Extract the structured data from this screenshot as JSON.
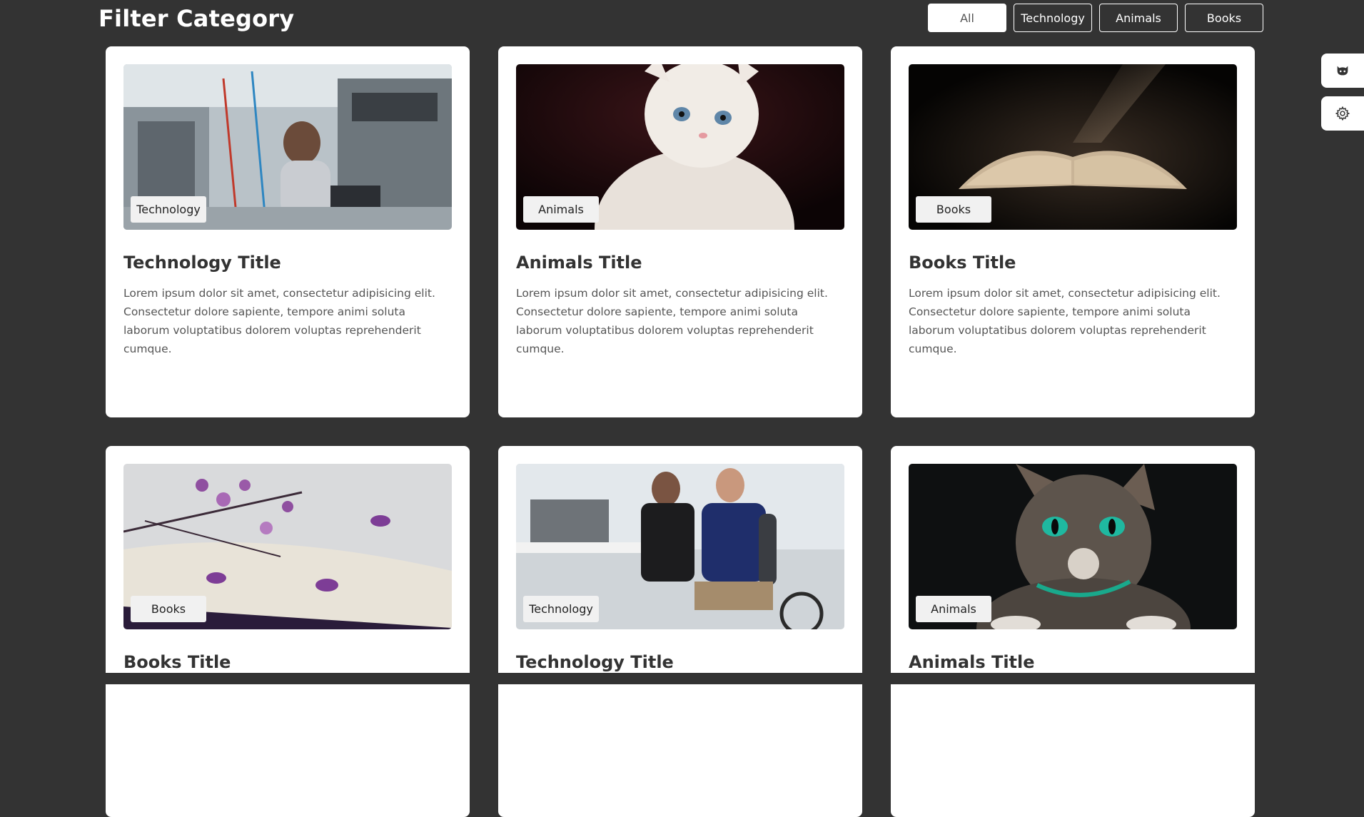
{
  "header": {
    "title": "Filter Category"
  },
  "filters": [
    {
      "label": "All",
      "active": true
    },
    {
      "label": "Technology",
      "active": false
    },
    {
      "label": "Animals",
      "active": false
    },
    {
      "label": "Books",
      "active": false
    }
  ],
  "cards": [
    {
      "tag": "Technology",
      "title": "Technology Title",
      "text": "Lorem ipsum dolor sit amet, consectetur adipisicing elit. Consectetur dolore sapiente, tempore animi soluta laborum voluptatibus dolorem voluptas reprehenderit cumque."
    },
    {
      "tag": "Animals",
      "title": "Animals Title",
      "text": "Lorem ipsum dolor sit amet, consectetur adipisicing elit. Consectetur dolore sapiente, tempore animi soluta laborum voluptatibus dolorem voluptas reprehenderit cumque."
    },
    {
      "tag": "Books",
      "title": "Books Title",
      "text": "Lorem ipsum dolor sit amet, consectetur adipisicing elit. Consectetur dolore sapiente, tempore animi soluta laborum voluptatibus dolorem voluptas reprehenderit cumque."
    },
    {
      "tag": "Books",
      "title": "Books Title",
      "text": ""
    },
    {
      "tag": "Technology",
      "title": "Technology Title",
      "text": ""
    },
    {
      "tag": "Animals",
      "title": "Animals Title",
      "text": ""
    }
  ],
  "side_tools": [
    {
      "icon": "github-cat-icon"
    },
    {
      "icon": "gear-icon"
    }
  ],
  "colors": {
    "background": "#333333",
    "card": "#ffffff",
    "tag_bg": "#f1f1f1"
  }
}
